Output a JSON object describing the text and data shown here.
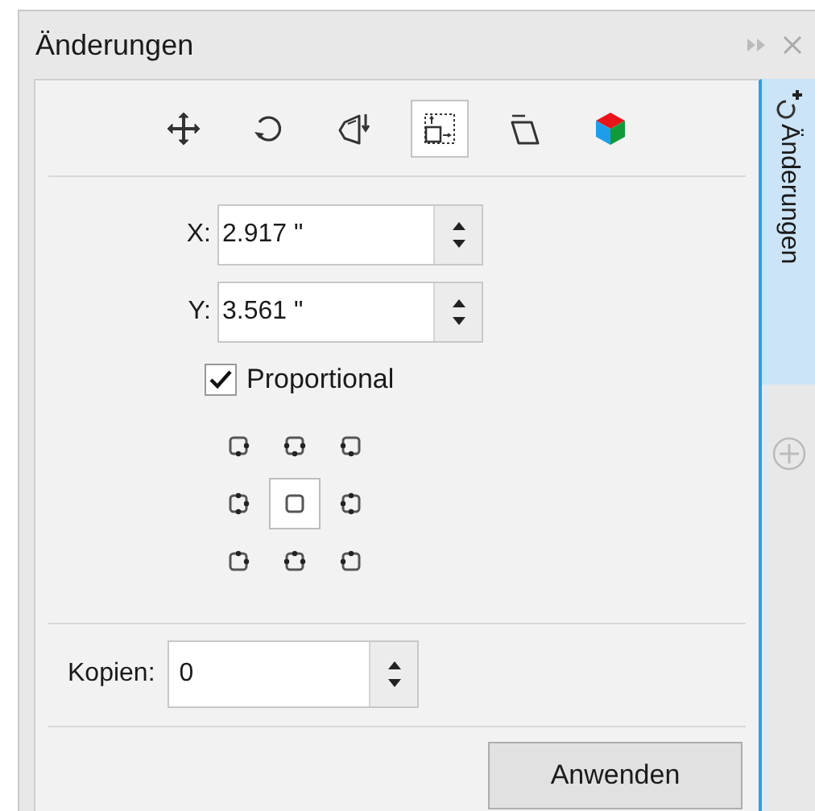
{
  "window": {
    "title": "Änderungen"
  },
  "tools": [
    {
      "kind": "move",
      "selected": false
    },
    {
      "kind": "rotate",
      "selected": false
    },
    {
      "kind": "mirror",
      "selected": false
    },
    {
      "kind": "size",
      "selected": true
    },
    {
      "kind": "skew",
      "selected": false
    },
    {
      "kind": "cube",
      "selected": false
    }
  ],
  "fields": [
    {
      "label": "X:",
      "value": "2.917 \""
    },
    {
      "label": "Y:",
      "value": "3.561 \""
    }
  ],
  "proportional": {
    "label": "Proportional",
    "checked": true
  },
  "anchors": [
    {
      "selected": false
    },
    {
      "selected": false
    },
    {
      "selected": false
    },
    {
      "selected": false
    },
    {
      "selected": true
    },
    {
      "selected": false
    },
    {
      "selected": false
    },
    {
      "selected": false
    },
    {
      "selected": false
    }
  ],
  "copies": {
    "label": "Kopien:",
    "value": "0"
  },
  "apply_button": "Anwenden",
  "side_tabs": [
    {
      "label": "Änderungen",
      "selected": true
    }
  ]
}
